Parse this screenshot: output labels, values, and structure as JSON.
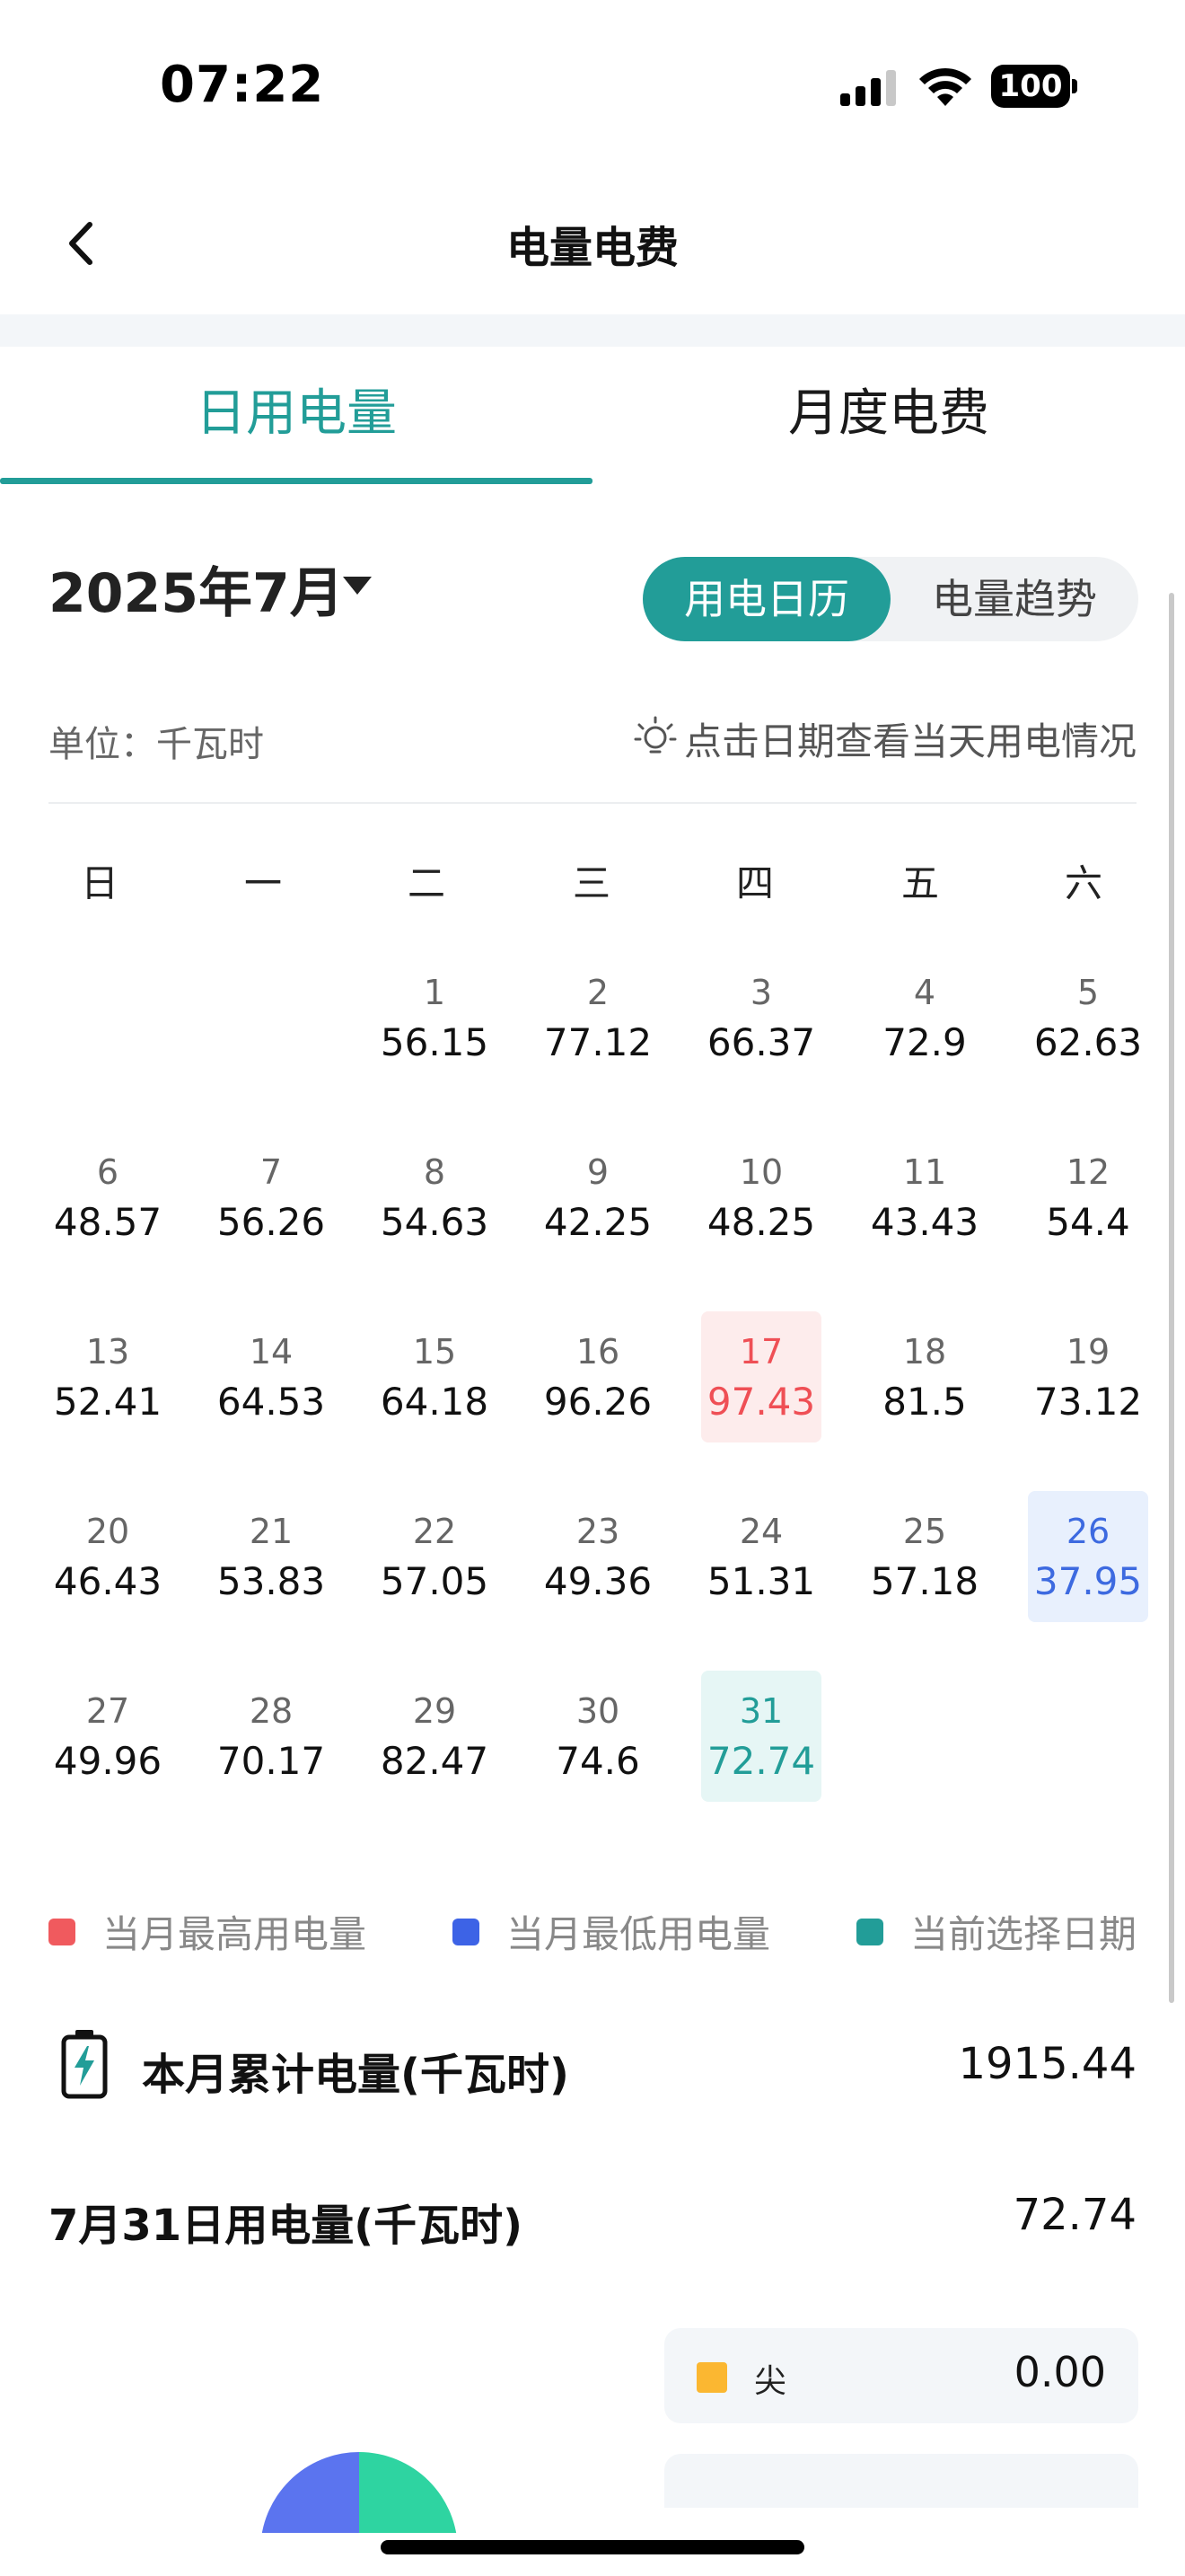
{
  "status": {
    "time": "07:22",
    "battery": "100"
  },
  "nav": {
    "title": "电量电费"
  },
  "tabs": [
    {
      "label": "日用电量",
      "active": true
    },
    {
      "label": "月度电费",
      "active": false
    }
  ],
  "month": {
    "label": "2025年7月"
  },
  "view_toggle": {
    "on": "用电日历",
    "off": "电量趋势"
  },
  "unit_label": "单位：千瓦时",
  "hint": "点击日期查看当天用电情况",
  "weekdays": [
    "日",
    "一",
    "二",
    "三",
    "四",
    "五",
    "六"
  ],
  "days": [
    {
      "d": "1",
      "v": "56.15"
    },
    {
      "d": "2",
      "v": "77.12"
    },
    {
      "d": "3",
      "v": "66.37"
    },
    {
      "d": "4",
      "v": "72.9"
    },
    {
      "d": "5",
      "v": "62.63"
    },
    {
      "d": "6",
      "v": "48.57"
    },
    {
      "d": "7",
      "v": "56.26"
    },
    {
      "d": "8",
      "v": "54.63"
    },
    {
      "d": "9",
      "v": "42.25"
    },
    {
      "d": "10",
      "v": "48.25"
    },
    {
      "d": "11",
      "v": "43.43"
    },
    {
      "d": "12",
      "v": "54.4"
    },
    {
      "d": "13",
      "v": "52.41"
    },
    {
      "d": "14",
      "v": "64.53"
    },
    {
      "d": "15",
      "v": "64.18"
    },
    {
      "d": "16",
      "v": "96.26"
    },
    {
      "d": "17",
      "v": "97.43"
    },
    {
      "d": "18",
      "v": "81.5"
    },
    {
      "d": "19",
      "v": "73.12"
    },
    {
      "d": "20",
      "v": "46.43"
    },
    {
      "d": "21",
      "v": "53.83"
    },
    {
      "d": "22",
      "v": "57.05"
    },
    {
      "d": "23",
      "v": "49.36"
    },
    {
      "d": "24",
      "v": "51.31"
    },
    {
      "d": "25",
      "v": "57.18"
    },
    {
      "d": "26",
      "v": "37.95"
    },
    {
      "d": "27",
      "v": "49.96"
    },
    {
      "d": "28",
      "v": "70.17"
    },
    {
      "d": "29",
      "v": "82.47"
    },
    {
      "d": "30",
      "v": "74.6"
    },
    {
      "d": "31",
      "v": "72.74"
    }
  ],
  "highlight": {
    "max_day": "17",
    "min_day": "26",
    "selected_day": "31"
  },
  "legend": [
    {
      "label": "当月最高用电量",
      "color": "#f05a5e"
    },
    {
      "label": "当月最低用电量",
      "color": "#3d63e6"
    },
    {
      "label": "当前选择日期",
      "color": "#229d98"
    }
  ],
  "summary": {
    "month_total_label": "本月累计电量(千瓦时)",
    "month_total_value": "1915.44",
    "day_label": "7月31日用电量(千瓦时)",
    "day_value": "72.74"
  },
  "tiers": [
    {
      "label": "尖",
      "value": "0.00",
      "color": "#fbb731"
    }
  ],
  "colors": {
    "accent": "#229d98",
    "max": "#ef4f55",
    "min": "#3d6ae0"
  }
}
